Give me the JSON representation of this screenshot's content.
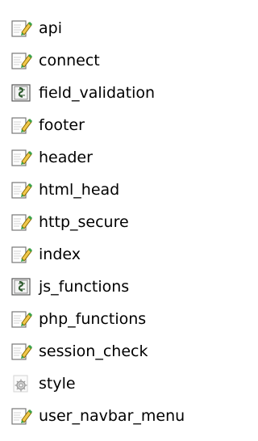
{
  "files": [
    {
      "name": "api",
      "icon": "php-file-icon"
    },
    {
      "name": "connect",
      "icon": "php-file-icon"
    },
    {
      "name": "field_validation",
      "icon": "js-file-icon"
    },
    {
      "name": "footer",
      "icon": "php-file-icon"
    },
    {
      "name": "header",
      "icon": "php-file-icon"
    },
    {
      "name": "html_head",
      "icon": "php-file-icon"
    },
    {
      "name": "http_secure",
      "icon": "php-file-icon"
    },
    {
      "name": "index",
      "icon": "php-file-icon"
    },
    {
      "name": "js_functions",
      "icon": "js-file-icon"
    },
    {
      "name": "php_functions",
      "icon": "php-file-icon"
    },
    {
      "name": "session_check",
      "icon": "php-file-icon"
    },
    {
      "name": "style",
      "icon": "css-file-icon"
    },
    {
      "name": "user_navbar_menu",
      "icon": "php-file-icon"
    }
  ],
  "colors": {
    "text": "#000000",
    "background": "#ffffff",
    "php_pencil": "#f2c94c",
    "php_accent": "#3aa34a",
    "js_badge": "#2f5b2f",
    "css_gear": "#9a9a9a"
  }
}
